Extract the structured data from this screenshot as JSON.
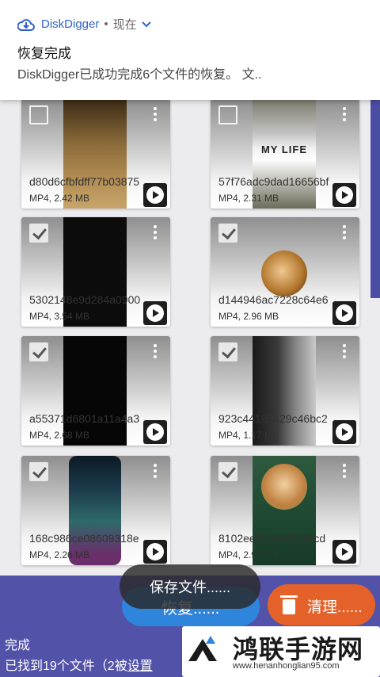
{
  "notification": {
    "app_name": "DiskDigger",
    "separator": "•",
    "time": "现在",
    "title": "恢复完成",
    "body": "DiskDigger已成功完成6个文件的恢复。 文.."
  },
  "files": [
    {
      "name": "d80d6cfbfdff77b03875",
      "meta": "MP4, 2.42 MB",
      "checked": false
    },
    {
      "name": "57f76adc9dad16656bf",
      "meta": "MP4, 2.31 MB",
      "checked": false,
      "overlay_text": "MY LIFE"
    },
    {
      "name": "5302148e9d284a0900",
      "meta": "MP4, 3.54 MB",
      "checked": true
    },
    {
      "name": "d144946ac7228c64e6",
      "meta": "MP4, 2.96 MB",
      "checked": true
    },
    {
      "name": "a55371d6801a11a4a3",
      "meta": "MP4, 2.68 MB",
      "checked": true
    },
    {
      "name": "923c44185429c46bc2",
      "meta": "MP4, 1.17 MB",
      "checked": true
    },
    {
      "name": "168c986ce08609318e",
      "meta": "MP4, 2.26 MB",
      "checked": true
    },
    {
      "name": "8102eeff4284f8140cd",
      "meta": "MP4, 2.92 MB",
      "checked": true
    }
  ],
  "actions": {
    "restore_label": "恢复......",
    "clean_label": "清理......",
    "toast": "保存文件......"
  },
  "status": {
    "line1": "完成",
    "line2_prefix": "已找到19个文件（2被",
    "line2_link": "设置"
  },
  "watermark": {
    "title": "鸿联手游网",
    "url": "www.henanhonglian95.com"
  },
  "colors": {
    "accent": "#5352a9",
    "restore": "#2f84dc",
    "clean": "#e4622a",
    "link": "#2f63c7"
  }
}
